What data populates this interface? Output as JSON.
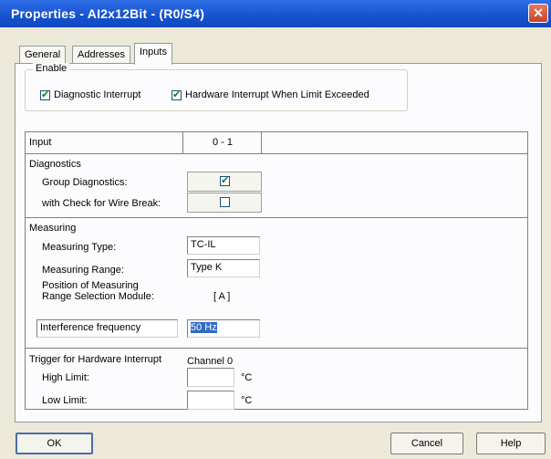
{
  "window": {
    "title": "Properties - AI2x12Bit - (R0/S4)",
    "close_glyph": "✕"
  },
  "tabs": [
    {
      "label": "General"
    },
    {
      "label": "Addresses"
    },
    {
      "label": "Inputs",
      "active": true
    }
  ],
  "enable": {
    "legend": "Enable",
    "diagnostic_interrupt": {
      "label": "Diagnostic Interrupt",
      "checked": true
    },
    "hardware_interrupt": {
      "label": "Hardware Interrupt When Limit Exceeded",
      "checked": true
    }
  },
  "grid": {
    "header": {
      "input": "Input",
      "channels": "0 - 1"
    },
    "diagnostics": {
      "section": "Diagnostics",
      "group_label": "Group Diagnostics:",
      "group_checked": true,
      "wire_label": "with Check for Wire Break:",
      "wire_checked": false
    },
    "measuring": {
      "section": "Measuring",
      "type_label": "Measuring Type:",
      "type_value": "TC-IL",
      "range_label": "Measuring Range:",
      "range_value": "Type K",
      "position_line1": "Position of Measuring",
      "position_line2": "Range Selection Module:",
      "position_value": "[ A ]",
      "interference_label": "Interference frequency",
      "interference_value": "50 Hz"
    },
    "trigger": {
      "section": "Trigger for Hardware Interrupt",
      "channel": "Channel 0",
      "high_label": "High Limit:",
      "high_value": "",
      "low_label": "Low Limit:",
      "low_value": "",
      "unit": "°C"
    }
  },
  "buttons": {
    "ok": "OK",
    "cancel": "Cancel",
    "help": "Help"
  }
}
